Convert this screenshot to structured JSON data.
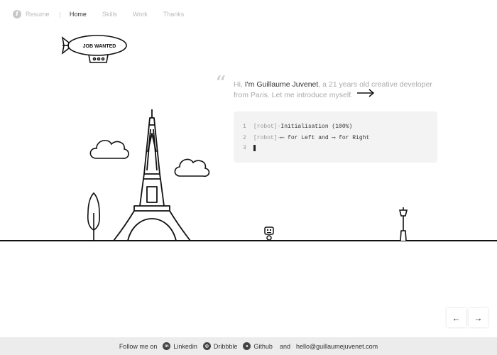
{
  "nav": {
    "items": [
      {
        "label": "Resume",
        "active": false
      },
      {
        "label": "Home",
        "active": true
      },
      {
        "label": "Skills",
        "active": false
      },
      {
        "label": "Work",
        "active": false
      },
      {
        "label": "Thanks",
        "active": false
      }
    ],
    "separator": "|"
  },
  "blimp": {
    "label": "JOB WANTED"
  },
  "intro": {
    "prefix": "Hi, ",
    "name": "I'm Guillaume Juvenet",
    "suffix": ", a 21 years old creative developer from Paris. Let me introduce myself."
  },
  "terminal": {
    "lines": [
      {
        "num": "1",
        "prompt": "[robot]-",
        "text": " Initialisation (100%)"
      },
      {
        "num": "2",
        "prompt": "[robot]-",
        "text": " ⟵ for Left and ⟶ for Right"
      },
      {
        "num": "3",
        "prompt": "",
        "text": ""
      }
    ]
  },
  "controls": {
    "prev": "←",
    "next": "→"
  },
  "footer": {
    "follow_label": "Follow me on",
    "linkedin": "Linkedin",
    "dribbble": "Dribbble",
    "github": "Github",
    "and": "and",
    "email": "hello@guillaumejuvenet.com"
  },
  "colors": {
    "line": "#111111",
    "muted": "#aaaaaa",
    "terminal_bg": "#f3f3f3",
    "footer_bg": "#ececec"
  }
}
